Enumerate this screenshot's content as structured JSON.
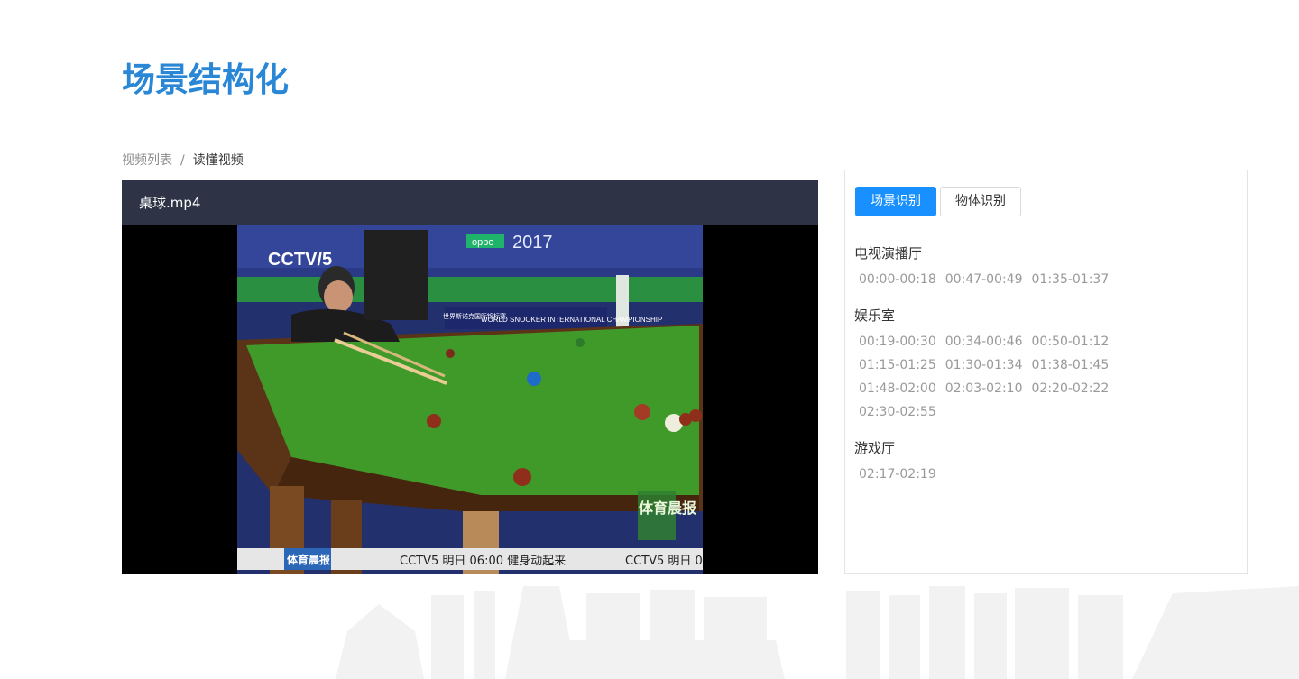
{
  "page_title": "场景结构化",
  "breadcrumb": {
    "parent": "视频列表",
    "separator": "/",
    "current": "读懂视频"
  },
  "player": {
    "filename": "桌球.mp4",
    "overlay": {
      "channel": "CCTV/5",
      "year": "2017",
      "brand": "oppo",
      "banner": "WORLD SNOOKER INTERNATIONAL CHAMPIONSHIP",
      "banner_cn": "世界斯诺克国际锦标赛",
      "show_logo": "体育晨报",
      "ticker_label": "体育晨报",
      "ticker_text": "CCTV5 明日 06:00 健身动起来",
      "ticker_text_2": "CCTV5 明日 0"
    }
  },
  "tabs": [
    {
      "label": "场景识别",
      "active": true
    },
    {
      "label": "物体识别",
      "active": false
    }
  ],
  "scenes": [
    {
      "title": "电视演播厅",
      "times": [
        "00:00-00:18",
        "00:47-00:49",
        "01:35-01:37"
      ]
    },
    {
      "title": "娱乐室",
      "times": [
        "00:19-00:30",
        "00:34-00:46",
        "00:50-01:12",
        "01:15-01:25",
        "01:30-01:34",
        "01:38-01:45",
        "01:48-02:00",
        "02:03-02:10",
        "02:20-02:22",
        "02:30-02:55"
      ]
    },
    {
      "title": "游戏厅",
      "times": [
        "02:17-02:19"
      ]
    }
  ],
  "colors": {
    "accent": "#1890ff",
    "title": "#2a87d6",
    "player_header": "#2e3445",
    "table_green": "#3f9a2a"
  }
}
